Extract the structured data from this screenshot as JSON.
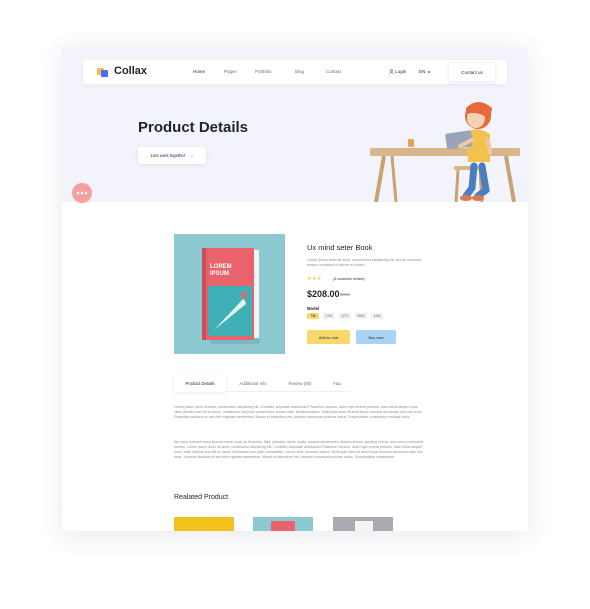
{
  "brand": {
    "name": "Collax"
  },
  "nav": {
    "links": [
      "Home",
      "Pages",
      "Portfolio",
      "Blog",
      "Contact"
    ],
    "login": "Login",
    "lang": "EN",
    "contact_button": "Contact us"
  },
  "hero": {
    "title": "Product Details",
    "button_label": "Lets work together",
    "button_arrow": "→"
  },
  "product": {
    "title": "Ux mind seter Book",
    "description": "Lorem ipsum dolor sit amet, consectetur adipiscing elit, sed do eiusmod tempor incididunt ut labore et dolore.",
    "stars": "★★★",
    "reviews": "(4 customer review)",
    "price": "$208.00",
    "old_price": "$358",
    "model_label": "Model",
    "models": [
      "736",
      "2761",
      "3271",
      "8682",
      "1464"
    ],
    "book_cover_text": "LOREM IPSUM",
    "add_to_cart": "Add to cart",
    "buy_now": "Buy now"
  },
  "tabs": [
    "Product Details",
    "Additional Info",
    "Review (00)",
    "Faq"
  ],
  "details": {
    "paragraph1": "Lorem ipsum dolor sit amet, consectetur adipiscing elit. Curabitur vulputate vestibulum Phasellus rhoncus, dolor eget viverra pretium, dolor tellus aliquet nunc, vitae ultricies erat elit eu lacus. Vestibulum non justo consectetur, cursus ante, tincidunt sapien. Nulla quis diam sit amet turpis rhoncus accumsan quis nec risus. Phasellus faucibus ex sed nibh egestas elementum. Mauris et bibendum est. Aenean consequat pulvinar luctus. Suspendisse consectetur tristique tortor.",
    "paragraph2": "We have covered many special events such as fireworks, fairs, parades, races, walks, awards ceremonies, fashion shows, sporting events, and even a memorial service. Lorem ipsum dolor sit amet, consectetur adipiscing elit. Curabitur vulputate vestibulum Phasellus rhoncus, dolor eget viverra pretium, dolor tellus aliquet nunc, vitae ultricies erat elit eu lacus. Vestibulum non justo consectetur, cursus ante, tincidunt sapien. Nulla quis diam sit amet turpis rhoncus accumsan quis nec risus. Vivamus faucibus et sed nibh egestas elementum. Mauris et bibendum est. Aenean consequat pulvinar luctus. Suspendisse consectetur."
  },
  "related": {
    "title": "Realated Product"
  },
  "colors": {
    "hero_bg": "#f3f4fb",
    "accent_yellow": "#f8d86a",
    "accent_blue": "#a8d3f3",
    "book_red": "#e8636b",
    "book_teal": "#3fb0b5"
  }
}
